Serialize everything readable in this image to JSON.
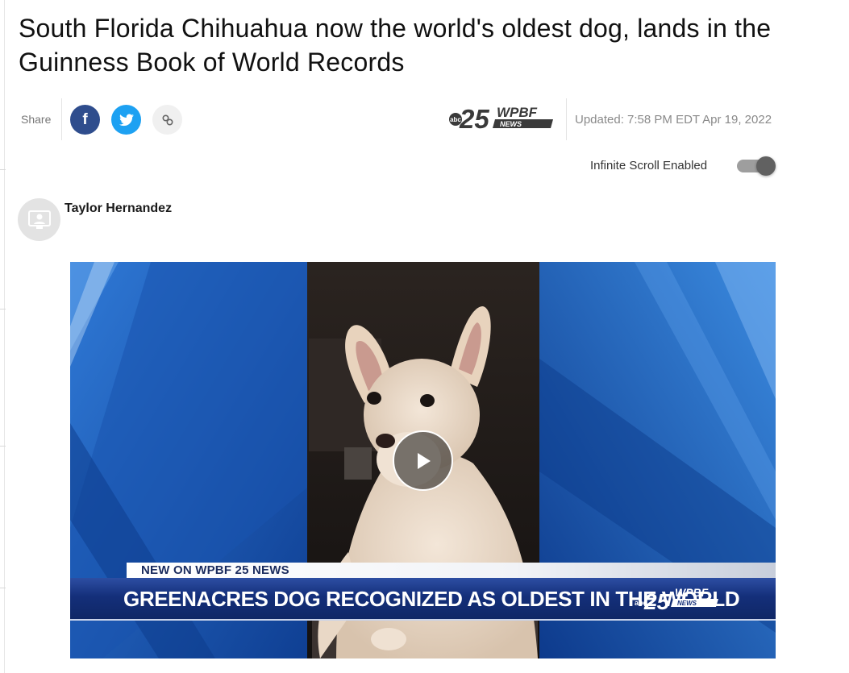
{
  "article": {
    "headline": "South Florida Chihuahua now the world's oldest dog, lands in the Guinness Book of World Records",
    "share_label": "Share",
    "updated": "Updated: 7:58 PM EDT Apr 19, 2022",
    "author": "Taylor Hernandez"
  },
  "share": {
    "facebook_glyph": "f",
    "twitter_icon": "twitter-bird-icon",
    "link_icon": "link-icon"
  },
  "station": {
    "number": "25",
    "name": "WPBF",
    "tag": "NEWS"
  },
  "settings": {
    "infinite_scroll_label": "Infinite Scroll Enabled",
    "infinite_scroll_on": true
  },
  "video": {
    "lower_third_top": "NEW ON WPBF 25 NEWS",
    "lower_third_main": "GREENACRES DOG RECOGNIZED AS OLDEST IN THE WORLD",
    "play_icon": "play-icon"
  },
  "colors": {
    "facebook": "#2f4d8d",
    "twitter": "#1da1f2",
    "video_blue": "#1e58b3",
    "lower_third_navy": "#142f7a"
  }
}
